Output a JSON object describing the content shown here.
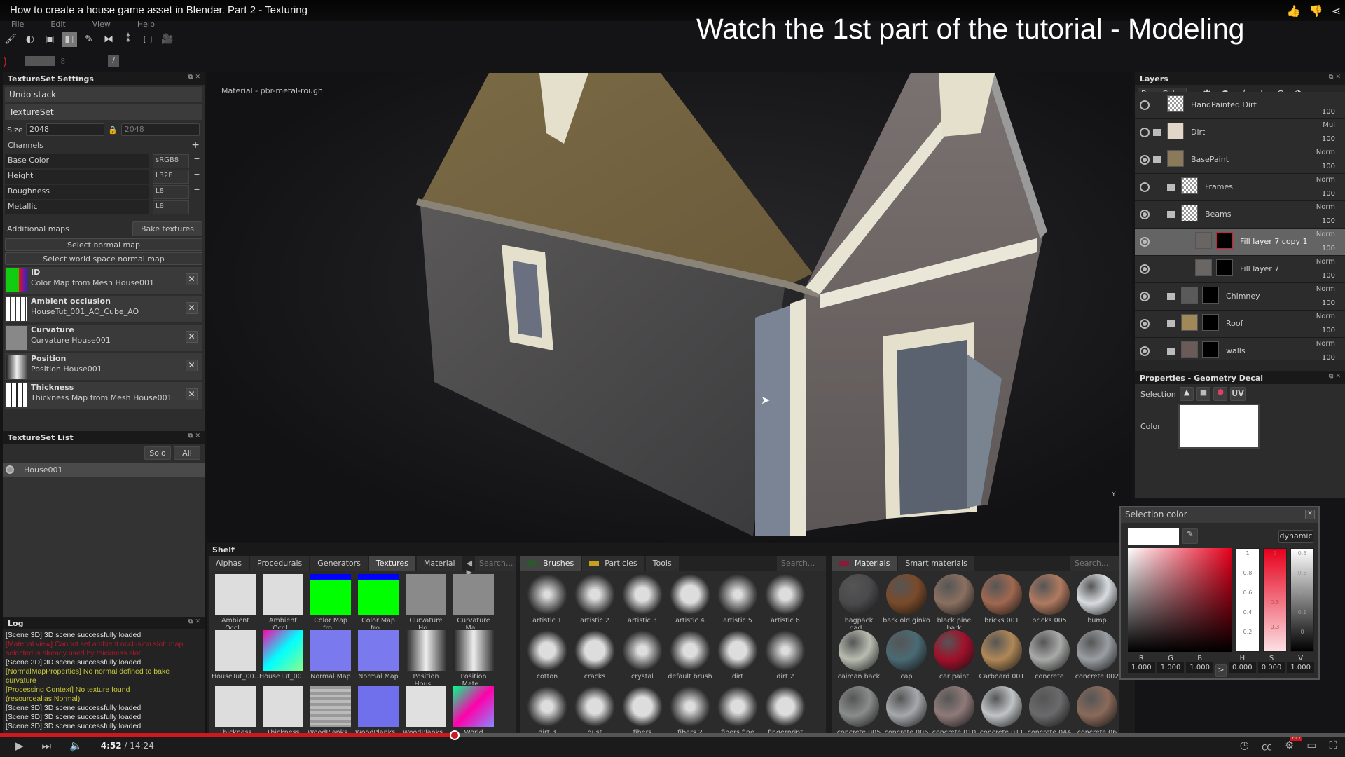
{
  "video": {
    "title": "How to create a house game asset in Blender. Part 2 - Texturing",
    "overlay": "Watch the 1st part of the tutorial - Modeling",
    "current_time": "4:52",
    "duration": "14:24",
    "progress": 0.338,
    "hd_badge": "HD",
    "accent": "#cc181e"
  },
  "menu": [
    "File",
    "Edit",
    "View",
    "Help"
  ],
  "toolbar2": {
    "size_value": "8"
  },
  "textureset_settings": {
    "title": "TextureSet Settings",
    "undo": "Undo stack",
    "textureset": "TextureSet",
    "size_label": "Size",
    "size_w": "2048",
    "size_h": "2048",
    "channels_label": "Channels",
    "channels": [
      {
        "name": "Base Color",
        "format": "sRGB8"
      },
      {
        "name": "Height",
        "format": "L32F"
      },
      {
        "name": "Roughness",
        "format": "L8"
      },
      {
        "name": "Metallic",
        "format": "L8"
      }
    ],
    "additional_maps": "Additional maps",
    "bake": "Bake textures",
    "select_normal": "Select normal map",
    "select_world": "Select world space normal map",
    "maps": [
      {
        "name": "ID",
        "source": "Color Map from Mesh House001"
      },
      {
        "name": "Ambient occlusion",
        "source": "HouseTut_001_AO_Cube_AO"
      },
      {
        "name": "Curvature",
        "source": "Curvature House001"
      },
      {
        "name": "Position",
        "source": "Position House001"
      },
      {
        "name": "Thickness",
        "source": "Thickness Map from Mesh House001"
      }
    ]
  },
  "textureset_list": {
    "title": "TextureSet List",
    "solo": "Solo",
    "all": "All",
    "items": [
      "House001"
    ]
  },
  "log": {
    "title": "Log",
    "lines": [
      {
        "text": "[Scene 3D] 3D scene successfully loaded",
        "color": "#e0e0e0"
      },
      {
        "text": "[Material view] Cannot set ambient occlusion slot: map selected is already used by thickness slot",
        "color": "#b0182a"
      },
      {
        "text": "[Scene 3D] 3D scene successfully loaded",
        "color": "#e0e0e0"
      },
      {
        "text": "[NormalMapProperties] No normal defined to bake curvature",
        "color": "#c8c83a"
      },
      {
        "text": "[Processing Context] No texture found (resourcealias:Normal)",
        "color": "#c8c83a"
      },
      {
        "text": "[Scene 3D] 3D scene successfully loaded",
        "color": "#e0e0e0"
      },
      {
        "text": "[Scene 3D] 3D scene successfully loaded",
        "color": "#e0e0e0"
      },
      {
        "text": "[Scene 3D] 3D scene successfully loaded",
        "color": "#e0e0e0"
      }
    ]
  },
  "viewport": {
    "material_label": "Material - pbr-metal-rough",
    "axis": "Y"
  },
  "shelf": {
    "title": "Shelf",
    "tabs": [
      "Alphas",
      "Procedurals",
      "Generators",
      "Textures",
      "Material"
    ],
    "active_tab": "Textures",
    "search": "Search...",
    "textures": [
      "Ambient Occl...",
      "Ambient Occl...",
      "Color Map fro...",
      "Color Map fro...",
      "Curvature Ho...",
      "Curvature Ma...",
      "HouseTut_00...",
      "HouseTut_00...",
      "Normal Map ...",
      "Normal Map ...",
      "Position Hous...",
      "Position Mate...",
      "Thickness Ma...",
      "Thickness Ma...",
      "WoodPlanks...",
      "WoodPlanks...",
      "WoodPlanks...",
      "World Space..."
    ],
    "brush_tabs": [
      "Brushes",
      "Particles",
      "Tools"
    ],
    "brushes": [
      "artistic 1",
      "artistic 2",
      "artistic 3",
      "artistic 4",
      "artistic 5",
      "artistic 6",
      "cotton",
      "cracks",
      "crystal",
      "default brush",
      "dirt",
      "dirt 2",
      "dirt 3",
      "dust",
      "fibers",
      "fibers 2",
      "fibers fine",
      "fingerprint"
    ],
    "material_tabs": [
      "Materials",
      "Smart materials"
    ],
    "materials": [
      {
        "name": "bagpack pad...",
        "color": "#4a4a4c"
      },
      {
        "name": "bark old ginko",
        "color": "#7a4a2a"
      },
      {
        "name": "black pine bark",
        "color": "#8a7060"
      },
      {
        "name": "bricks 001",
        "color": "#a06850"
      },
      {
        "name": "bricks 005",
        "color": "#b07a60"
      },
      {
        "name": "bump",
        "color": "#d8dce0"
      },
      {
        "name": "caiman back ...",
        "color": "#b8bcb0"
      },
      {
        "name": "cap",
        "color": "#4a6a74"
      },
      {
        "name": "car paint",
        "color": "#a0102a"
      },
      {
        "name": "Carboard 001",
        "color": "#b08858"
      },
      {
        "name": "concrete",
        "color": "#a8aaa8"
      },
      {
        "name": "concrete 002",
        "color": "#9a9ea2"
      },
      {
        "name": "concrete 005",
        "color": "#8a8c8c"
      },
      {
        "name": "concrete 006",
        "color": "#a6a8ac"
      },
      {
        "name": "concrete 010",
        "color": "#8e7a78"
      },
      {
        "name": "concrete 011",
        "color": "#c0c4c6"
      },
      {
        "name": "concrete 044",
        "color": "#6a6a6c"
      },
      {
        "name": "concrete 06",
        "color": "#8a6a5a"
      }
    ]
  },
  "layers": {
    "title": "Layers",
    "channel": "Base Color",
    "items": [
      {
        "name": "HandPainted Dirt",
        "blend": "",
        "opacity": "100",
        "visible": false,
        "indent": 0,
        "folder": false,
        "thumb": "checker",
        "mask": ""
      },
      {
        "name": "Dirt",
        "blend": "Mul",
        "opacity": "100",
        "visible": false,
        "indent": 0,
        "folder": true,
        "thumb": "#e2d6c8",
        "mask": ""
      },
      {
        "name": "BasePaint",
        "blend": "Norm",
        "opacity": "100",
        "visible": true,
        "indent": 0,
        "folder": true,
        "thumb": "#8a7a5a",
        "mask": ""
      },
      {
        "name": "Frames",
        "blend": "Norm",
        "opacity": "100",
        "visible": false,
        "indent": 1,
        "folder": true,
        "thumb": "checker",
        "mask": ""
      },
      {
        "name": "Beams",
        "blend": "Norm",
        "opacity": "100",
        "visible": true,
        "indent": 1,
        "folder": true,
        "thumb": "checker",
        "mask": ""
      },
      {
        "name": "Fill layer 7 copy 1",
        "blend": "Norm",
        "opacity": "100",
        "visible": true,
        "indent": 2,
        "folder": false,
        "thumb": "#6a6462",
        "mask": "#000",
        "selected": true
      },
      {
        "name": "Fill layer 7",
        "blend": "Norm",
        "opacity": "100",
        "visible": true,
        "indent": 2,
        "folder": false,
        "thumb": "#6a6664",
        "mask": "#000"
      },
      {
        "name": "Chimney",
        "blend": "Norm",
        "opacity": "100",
        "visible": true,
        "indent": 1,
        "folder": true,
        "thumb": "#5a5a5a",
        "mask": "#000"
      },
      {
        "name": "Roof",
        "blend": "Norm",
        "opacity": "100",
        "visible": true,
        "indent": 1,
        "folder": true,
        "thumb": "#a08858",
        "mask": "#000"
      },
      {
        "name": "walls",
        "blend": "Norm",
        "opacity": "100",
        "visible": true,
        "indent": 1,
        "folder": true,
        "thumb": "#6a5a58",
        "mask": "#000"
      }
    ]
  },
  "properties": {
    "title": "Properties - Geometry Decal",
    "selection": "Selection",
    "uv": "UV",
    "color_label": "Color",
    "color": "#ffffff"
  },
  "selection_color": {
    "title": "Selection color",
    "mode": "dynamic",
    "labels": [
      "R",
      "G",
      "B",
      "H",
      "S",
      "V"
    ],
    "values": [
      "1.000",
      "1.000",
      "1.000",
      "0.000",
      "0.000",
      "1.000"
    ],
    "arrow": ">",
    "h_ticks": [
      "1",
      "0.8",
      "0.6",
      "0.4",
      "0.2"
    ],
    "s_ticks": [
      "1",
      "0.8",
      "0.5",
      "0.3"
    ],
    "v_ticks": [
      "0.8",
      "0.5",
      "0.3",
      "0.1",
      "0"
    ]
  }
}
